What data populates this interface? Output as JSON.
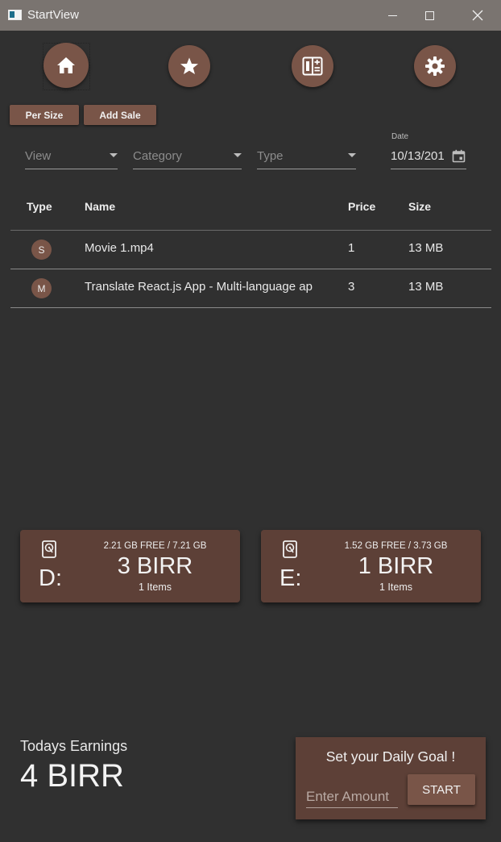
{
  "window": {
    "title": "StartView",
    "icons": [
      "app-icon",
      "minimize-icon",
      "maximize-icon",
      "close-icon"
    ]
  },
  "nav": {
    "icons": [
      "home-icon",
      "star-icon",
      "calculator-icon",
      "gear-icon"
    ]
  },
  "toolbar": {
    "per_size_label": "Per Size",
    "add_sale_label": "Add Sale"
  },
  "filters": {
    "view_label": "View",
    "category_label": "Category",
    "type_label": "Type",
    "date_caption": "Date",
    "date_value": "10/13/201"
  },
  "table": {
    "headers": {
      "type": "Type",
      "name": "Name",
      "price": "Price",
      "size": "Size"
    },
    "rows": [
      {
        "type": "S",
        "name": "Movie 1.mp4",
        "price": "1",
        "size": "13 MB"
      },
      {
        "type": "M",
        "name": "Translate React.js App - Multi-language ap",
        "price": "3",
        "size": "13 MB"
      }
    ]
  },
  "drives": [
    {
      "letter": "D:",
      "free": "2.21 GB FREE / 7.21 GB",
      "amount": "3 BIRR",
      "items": "1 Items"
    },
    {
      "letter": "E:",
      "free": "1.52 GB FREE / 3.73 GB",
      "amount": "1 BIRR",
      "items": "1 Items"
    }
  ],
  "earnings": {
    "label": "Todays Earnings",
    "value": "4 BIRR"
  },
  "goal": {
    "title": "Set your Daily Goal !",
    "input_placeholder": "Enter Amount",
    "start_label": "START"
  },
  "colors": {
    "background": "#303030",
    "titlebar": "#7a7470",
    "accent": "#795548",
    "card": "#5d4037"
  }
}
